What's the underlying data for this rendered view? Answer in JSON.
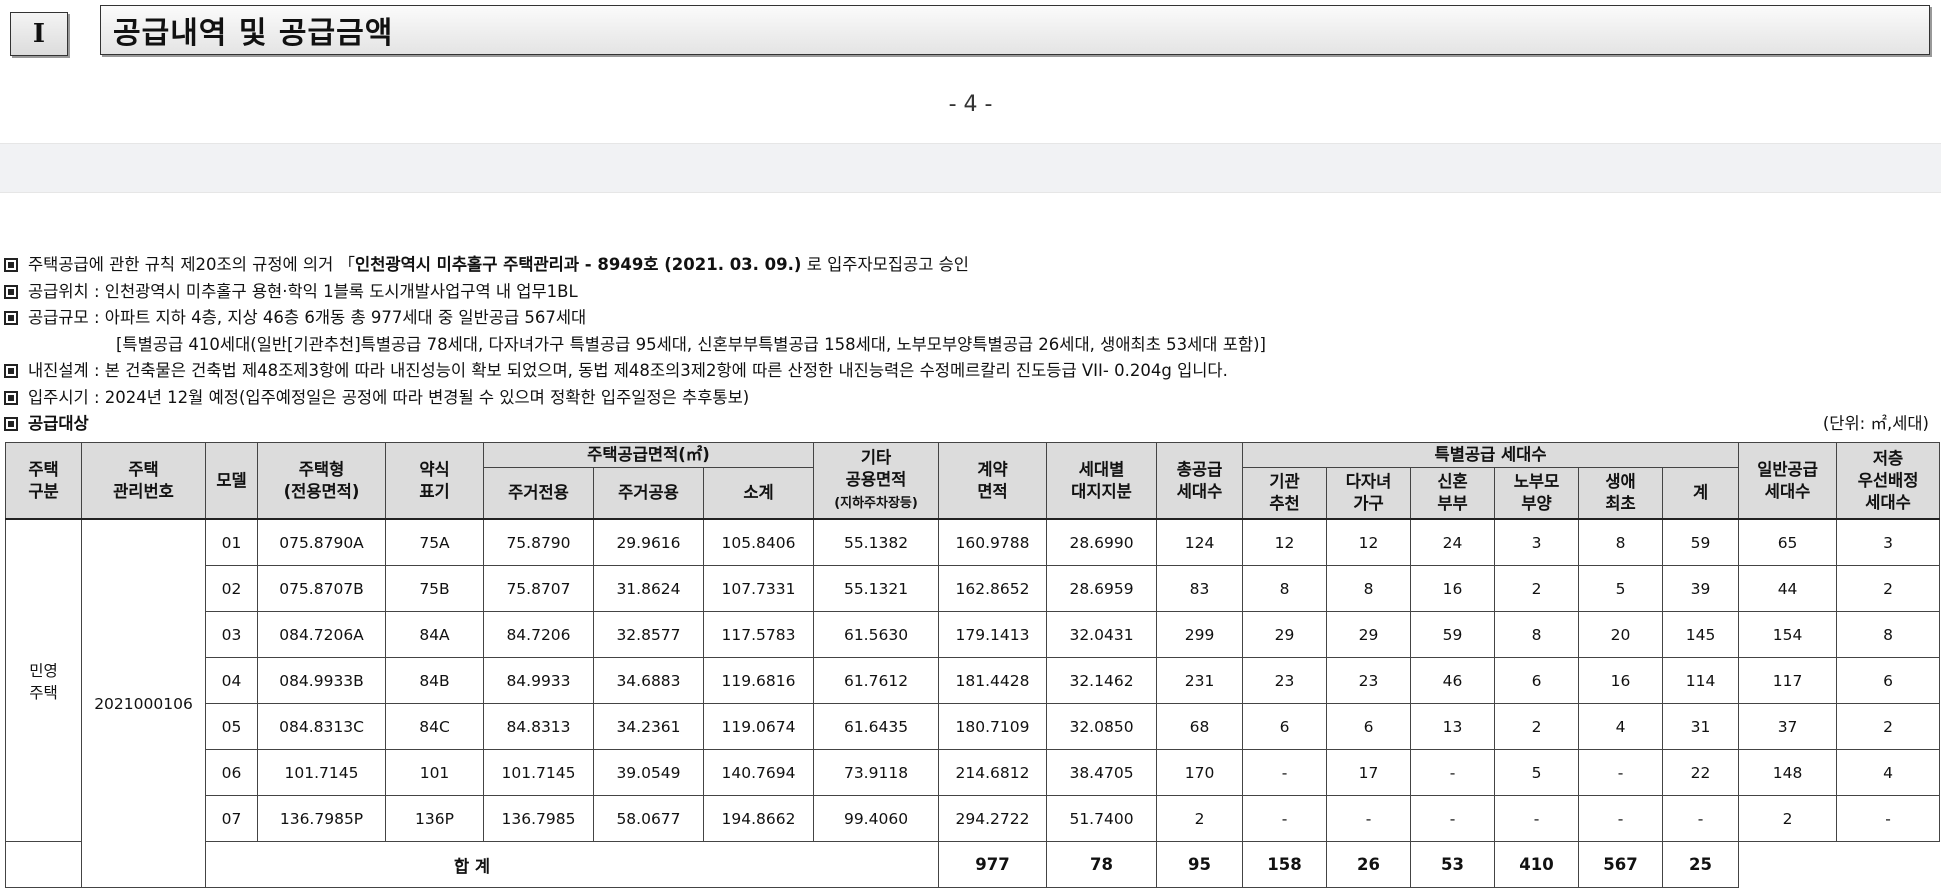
{
  "header": {
    "section_number": "I",
    "section_title": "공급내역 및 공급금액",
    "page_number": "- 4 -"
  },
  "notices": {
    "line1_prefix": "주택공급에 관한 규칙 제20조의 규정에 의거 「",
    "line1_bold": "인천광역시 미추홀구 주택관리과 - 8949호 (2021. 03. 09.)",
    "line1_suffix": " 로 입주자모집공고 승인",
    "line2": "공급위치 : 인천광역시 미추홀구 용현·학익 1블록 도시개발사업구역 내 업무1BL",
    "line3": "공급규모 : 아파트 지하 4층, 지상 46층 6개동 총 977세대 중 일반공급 567세대",
    "line3b": "[특별공급 410세대(일반[기관추천]특별공급 78세대, 다자녀가구 특별공급 95세대, 신혼부부특별공급 158세대, 노부모부양특별공급 26세대, 생애최초 53세대 포함)]",
    "line4": "내진설계 : 본 건축물은 건축법 제48조제3항에 따라 내진성능이 확보 되었으며, 동법 제48조의3제2항에 따른 산정한 내진능력은 수정메르칼리 진도등급 VII- 0.204g 입니다.",
    "line5": "입주시기 : 2024년 12월 예정(입주예정일은 공정에 따라 변경될 수 있으며 정확한 입주일정은 추후통보)",
    "target_label": "공급대상",
    "unit_label": "(단위: ㎡,세대)"
  },
  "table": {
    "headers": {
      "house_type_1": "주택",
      "house_type_2": "구분",
      "mgmt_1": "주택",
      "mgmt_2": "관리번호",
      "model": "모델",
      "htype_1": "주택형",
      "htype_2": "(전용면적)",
      "abbr_1": "약식",
      "abbr_2": "표기",
      "area_group": "주택공급면적(㎡)",
      "area_private": "주거전용",
      "area_common": "주거공용",
      "area_subtotal": "소계",
      "other_1": "기타",
      "other_2": "공용면적",
      "other_3": "(지하주차장등)",
      "contract_1": "계약",
      "contract_2": "면적",
      "land_1": "세대별",
      "land_2": "대지지분",
      "total_1": "총공급",
      "total_2": "세대수",
      "special_group": "특별공급 세대수",
      "sp_inst_1": "기관",
      "sp_inst_2": "추천",
      "sp_multi_1": "다자녀",
      "sp_multi_2": "가구",
      "sp_newly_1": "신혼",
      "sp_newly_2": "부부",
      "sp_elder_1": "노부모",
      "sp_elder_2": "부양",
      "sp_first_1": "생애",
      "sp_first_2": "최초",
      "sp_sum": "계",
      "general_1": "일반공급",
      "general_2": "세대수",
      "low_1": "저층",
      "low_2": "우선배정",
      "low_3": "세대수"
    },
    "house_type": [
      "민영",
      "주택"
    ],
    "mgmt_no": "2021000106",
    "rows": [
      {
        "model": "01",
        "htype": "075.8790A",
        "abbr": "75A",
        "private": "75.8790",
        "common": "29.9616",
        "subtotal": "105.8406",
        "other": "55.1382",
        "contract": "160.9788",
        "land": "28.6990",
        "total": "124",
        "inst": "12",
        "multi": "12",
        "newly": "24",
        "elder": "3",
        "first": "8",
        "sp_sum": "59",
        "general": "65",
        "low": "3"
      },
      {
        "model": "02",
        "htype": "075.8707B",
        "abbr": "75B",
        "private": "75.8707",
        "common": "31.8624",
        "subtotal": "107.7331",
        "other": "55.1321",
        "contract": "162.8652",
        "land": "28.6959",
        "total": "83",
        "inst": "8",
        "multi": "8",
        "newly": "16",
        "elder": "2",
        "first": "5",
        "sp_sum": "39",
        "general": "44",
        "low": "2"
      },
      {
        "model": "03",
        "htype": "084.7206A",
        "abbr": "84A",
        "private": "84.7206",
        "common": "32.8577",
        "subtotal": "117.5783",
        "other": "61.5630",
        "contract": "179.1413",
        "land": "32.0431",
        "total": "299",
        "inst": "29",
        "multi": "29",
        "newly": "59",
        "elder": "8",
        "first": "20",
        "sp_sum": "145",
        "general": "154",
        "low": "8"
      },
      {
        "model": "04",
        "htype": "084.9933B",
        "abbr": "84B",
        "private": "84.9933",
        "common": "34.6883",
        "subtotal": "119.6816",
        "other": "61.7612",
        "contract": "181.4428",
        "land": "32.1462",
        "total": "231",
        "inst": "23",
        "multi": "23",
        "newly": "46",
        "elder": "6",
        "first": "16",
        "sp_sum": "114",
        "general": "117",
        "low": "6"
      },
      {
        "model": "05",
        "htype": "084.8313C",
        "abbr": "84C",
        "private": "84.8313",
        "common": "34.2361",
        "subtotal": "119.0674",
        "other": "61.6435",
        "contract": "180.7109",
        "land": "32.0850",
        "total": "68",
        "inst": "6",
        "multi": "6",
        "newly": "13",
        "elder": "2",
        "first": "4",
        "sp_sum": "31",
        "general": "37",
        "low": "2"
      },
      {
        "model": "06",
        "htype": "101.7145",
        "abbr": "101",
        "private": "101.7145",
        "common": "39.0549",
        "subtotal": "140.7694",
        "other": "73.9118",
        "contract": "214.6812",
        "land": "38.4705",
        "total": "170",
        "inst": "-",
        "multi": "17",
        "newly": "-",
        "elder": "5",
        "first": "-",
        "sp_sum": "22",
        "general": "148",
        "low": "4"
      },
      {
        "model": "07",
        "htype": "136.7985P",
        "abbr": "136P",
        "private": "136.7985",
        "common": "58.0677",
        "subtotal": "194.8662",
        "other": "99.4060",
        "contract": "294.2722",
        "land": "51.7400",
        "total": "2",
        "inst": "-",
        "multi": "-",
        "newly": "-",
        "elder": "-",
        "first": "-",
        "sp_sum": "-",
        "general": "2",
        "low": "-"
      }
    ],
    "total_row": {
      "label": "합 계",
      "total": "977",
      "inst": "78",
      "multi": "95",
      "newly": "158",
      "elder": "26",
      "first": "53",
      "sp_sum": "410",
      "general": "567",
      "low": "25"
    }
  }
}
